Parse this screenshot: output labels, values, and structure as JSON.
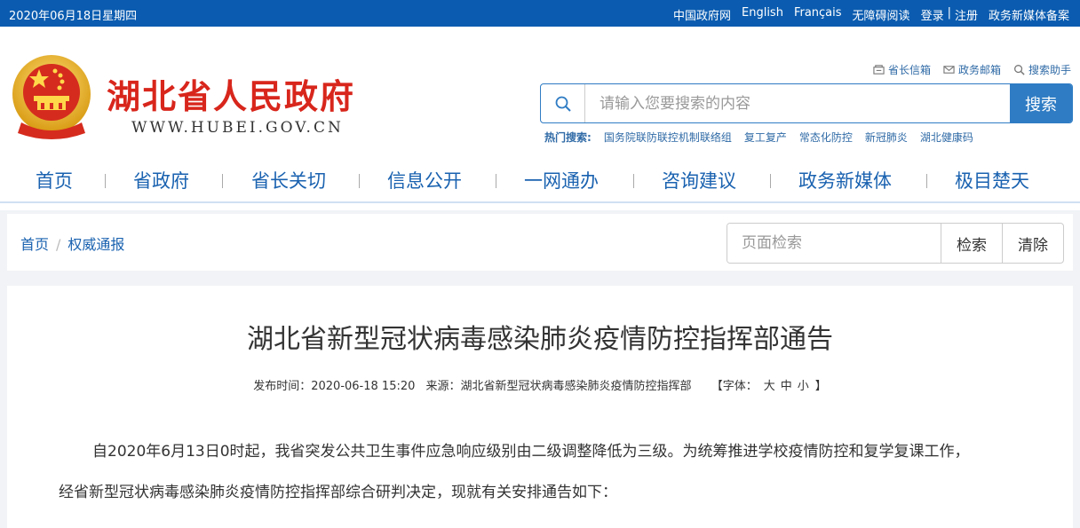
{
  "topbar": {
    "date": "2020年06月18日星期四",
    "links": [
      "中国政府网",
      "English",
      "Français",
      "无障碍阅读",
      "登录",
      "注册",
      "政务新媒体备案"
    ],
    "separator": "|"
  },
  "header": {
    "site_title": "湖北省人民政府",
    "site_url": "WWW.HUBEI.GOV.CN",
    "quicklinks": [
      {
        "label": "省长信箱",
        "icon": "mailbox-icon"
      },
      {
        "label": "政务邮箱",
        "icon": "envelope-icon"
      },
      {
        "label": "搜索助手",
        "icon": "search-icon"
      }
    ],
    "search": {
      "placeholder": "请输入您要搜索的内容",
      "button": "搜索"
    },
    "hot_search": {
      "label": "热门搜索:",
      "items": [
        "国务院联防联控机制联络组",
        "复工复产",
        "常态化防控",
        "新冠肺炎",
        "湖北健康码"
      ]
    }
  },
  "nav": {
    "items": [
      "首页",
      "省政府",
      "省长关切",
      "信息公开",
      "一网通办",
      "咨询建议",
      "政务新媒体",
      "极目楚天"
    ]
  },
  "breadcrumb": {
    "items": [
      "首页",
      "权威通报"
    ],
    "separator": "/"
  },
  "page_search": {
    "placeholder": "页面检索",
    "search_button": "检索",
    "clear_button": "清除"
  },
  "article": {
    "title": "湖北省新型冠状病毒感染肺炎疫情防控指挥部通告",
    "published": "发布时间：2020-06-18 15:20",
    "source": "来源：湖北省新型冠状病毒感染肺炎疫情防控指挥部",
    "font_label": "【字体：",
    "font_sizes": [
      "大",
      "中",
      "小"
    ],
    "font_close": "】",
    "paragraph1": "自2020年6月13日0时起，我省突发公共卫生事件应急响应级别由二级调整降低为三级。为统筹推进学校疫情防控和复学复课工作，",
    "paragraph2": "经省新型冠状病毒感染肺炎疫情防控指挥部综合研判决定，现就有关安排通告如下："
  },
  "colors": {
    "topbar": "#0b5cb0",
    "title_red": "#d8261c",
    "nav_blue": "#1a62b0",
    "search_blue": "#2f7cc4"
  }
}
